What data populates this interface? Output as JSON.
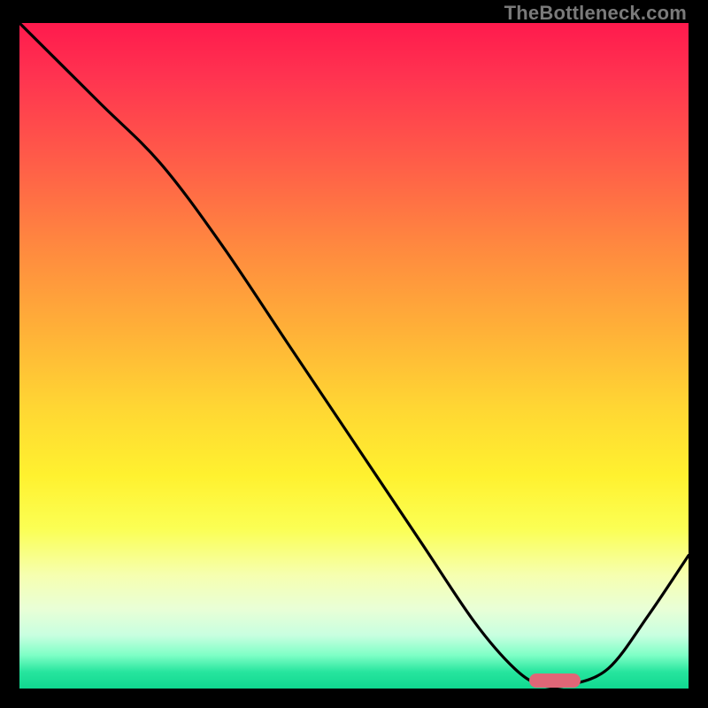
{
  "watermark": "TheBottleneck.com",
  "chart_data": {
    "type": "line",
    "title": "",
    "xlabel": "",
    "ylabel": "",
    "xlim": [
      0,
      100
    ],
    "ylim": [
      0,
      100
    ],
    "series": [
      {
        "name": "curve",
        "x": [
          0,
          12,
          21,
          30,
          40,
          50,
          60,
          68,
          74,
          78,
          82,
          88,
          94,
          100
        ],
        "y": [
          100,
          88,
          79,
          67,
          52,
          37,
          22,
          10,
          3,
          0.5,
          0.5,
          3,
          11,
          20
        ]
      }
    ],
    "marker": {
      "x": 80,
      "y": 1.2,
      "label": "optimal-range"
    },
    "gradient_stops": [
      {
        "pos": 0,
        "color": "#ff1a4d"
      },
      {
        "pos": 0.34,
        "color": "#ff8a3f"
      },
      {
        "pos": 0.68,
        "color": "#fff12f"
      },
      {
        "pos": 0.92,
        "color": "#c8ffe0"
      },
      {
        "pos": 1.0,
        "color": "#10d890"
      }
    ]
  }
}
